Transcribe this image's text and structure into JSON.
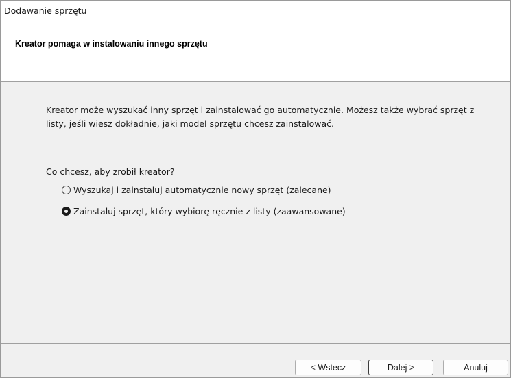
{
  "window": {
    "title": "Dodawanie sprzętu"
  },
  "header": {
    "title": "Kreator pomaga w instalowaniu innego sprzętu"
  },
  "main": {
    "description": "Kreator może wyszukać inny sprzęt i zainstalować go automatycznie. Możesz także wybrać sprzęt z listy, jeśli wiesz dokładnie, jaki model sprzętu chcesz zainstalować.",
    "question": "Co chcesz, aby zrobił kreator?",
    "options": [
      {
        "label": "Wyszukaj i zainstaluj automatycznie nowy sprzęt (zalecane)",
        "selected": false
      },
      {
        "label": "Zainstaluj sprzęt, który wybiorę ręcznie z listy (zaawansowane)",
        "selected": true
      }
    ]
  },
  "footer": {
    "back_label": "< Wstecz",
    "next_label": "Dalej >",
    "cancel_label": "Anuluj"
  }
}
